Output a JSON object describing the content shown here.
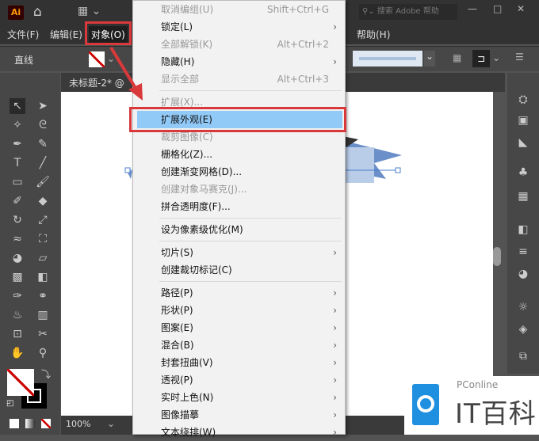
{
  "app": {
    "logo": "Ai",
    "search_placeholder": "搜索 Adobe 帮助"
  },
  "menubar": [
    {
      "label": "文件(F)"
    },
    {
      "label": "编辑(E)"
    },
    {
      "label": "对象(O)"
    },
    {
      "label": "帮助(H)"
    }
  ],
  "control": {
    "tool_name": "直线"
  },
  "tab": {
    "title": "未标题-2* @"
  },
  "status": {
    "zoom": "100%"
  },
  "menu": {
    "items": [
      {
        "label": "取消编组(U)",
        "shortcut": "Shift+Ctrl+G",
        "disabled": true
      },
      {
        "label": "锁定(L)",
        "submenu": true
      },
      {
        "label": "全部解锁(K)",
        "shortcut": "Alt+Ctrl+2",
        "disabled": true
      },
      {
        "label": "隐藏(H)",
        "submenu": true
      },
      {
        "label": "显示全部",
        "shortcut": "Alt+Ctrl+3",
        "disabled": true
      },
      {
        "label": "扩展(X)...",
        "disabled": true
      },
      {
        "label": "扩展外观(E)",
        "highlighted": true
      },
      {
        "label": "裁剪图像(C)",
        "disabled": true
      },
      {
        "label": "栅格化(Z)..."
      },
      {
        "label": "创建渐变网格(D)..."
      },
      {
        "label": "创建对象马赛克(J)...",
        "disabled": true
      },
      {
        "label": "拼合透明度(F)..."
      },
      {
        "label": "设为像素级优化(M)"
      },
      {
        "label": "切片(S)",
        "submenu": true
      },
      {
        "label": "创建裁切标记(C)"
      },
      {
        "label": "路径(P)",
        "submenu": true
      },
      {
        "label": "形状(P)",
        "submenu": true
      },
      {
        "label": "图案(E)",
        "submenu": true
      },
      {
        "label": "混合(B)",
        "submenu": true
      },
      {
        "label": "封套扭曲(V)",
        "submenu": true
      },
      {
        "label": "透视(P)",
        "submenu": true
      },
      {
        "label": "实时上色(N)",
        "submenu": true
      },
      {
        "label": "图像描摹",
        "submenu": true
      },
      {
        "label": "文本绕排(W)",
        "submenu": true
      }
    ]
  },
  "watermark": {
    "brand": "PConline",
    "name": "IT百科"
  },
  "colors": {
    "highlight": "#91c9f7",
    "annotation": "#d9393b"
  }
}
